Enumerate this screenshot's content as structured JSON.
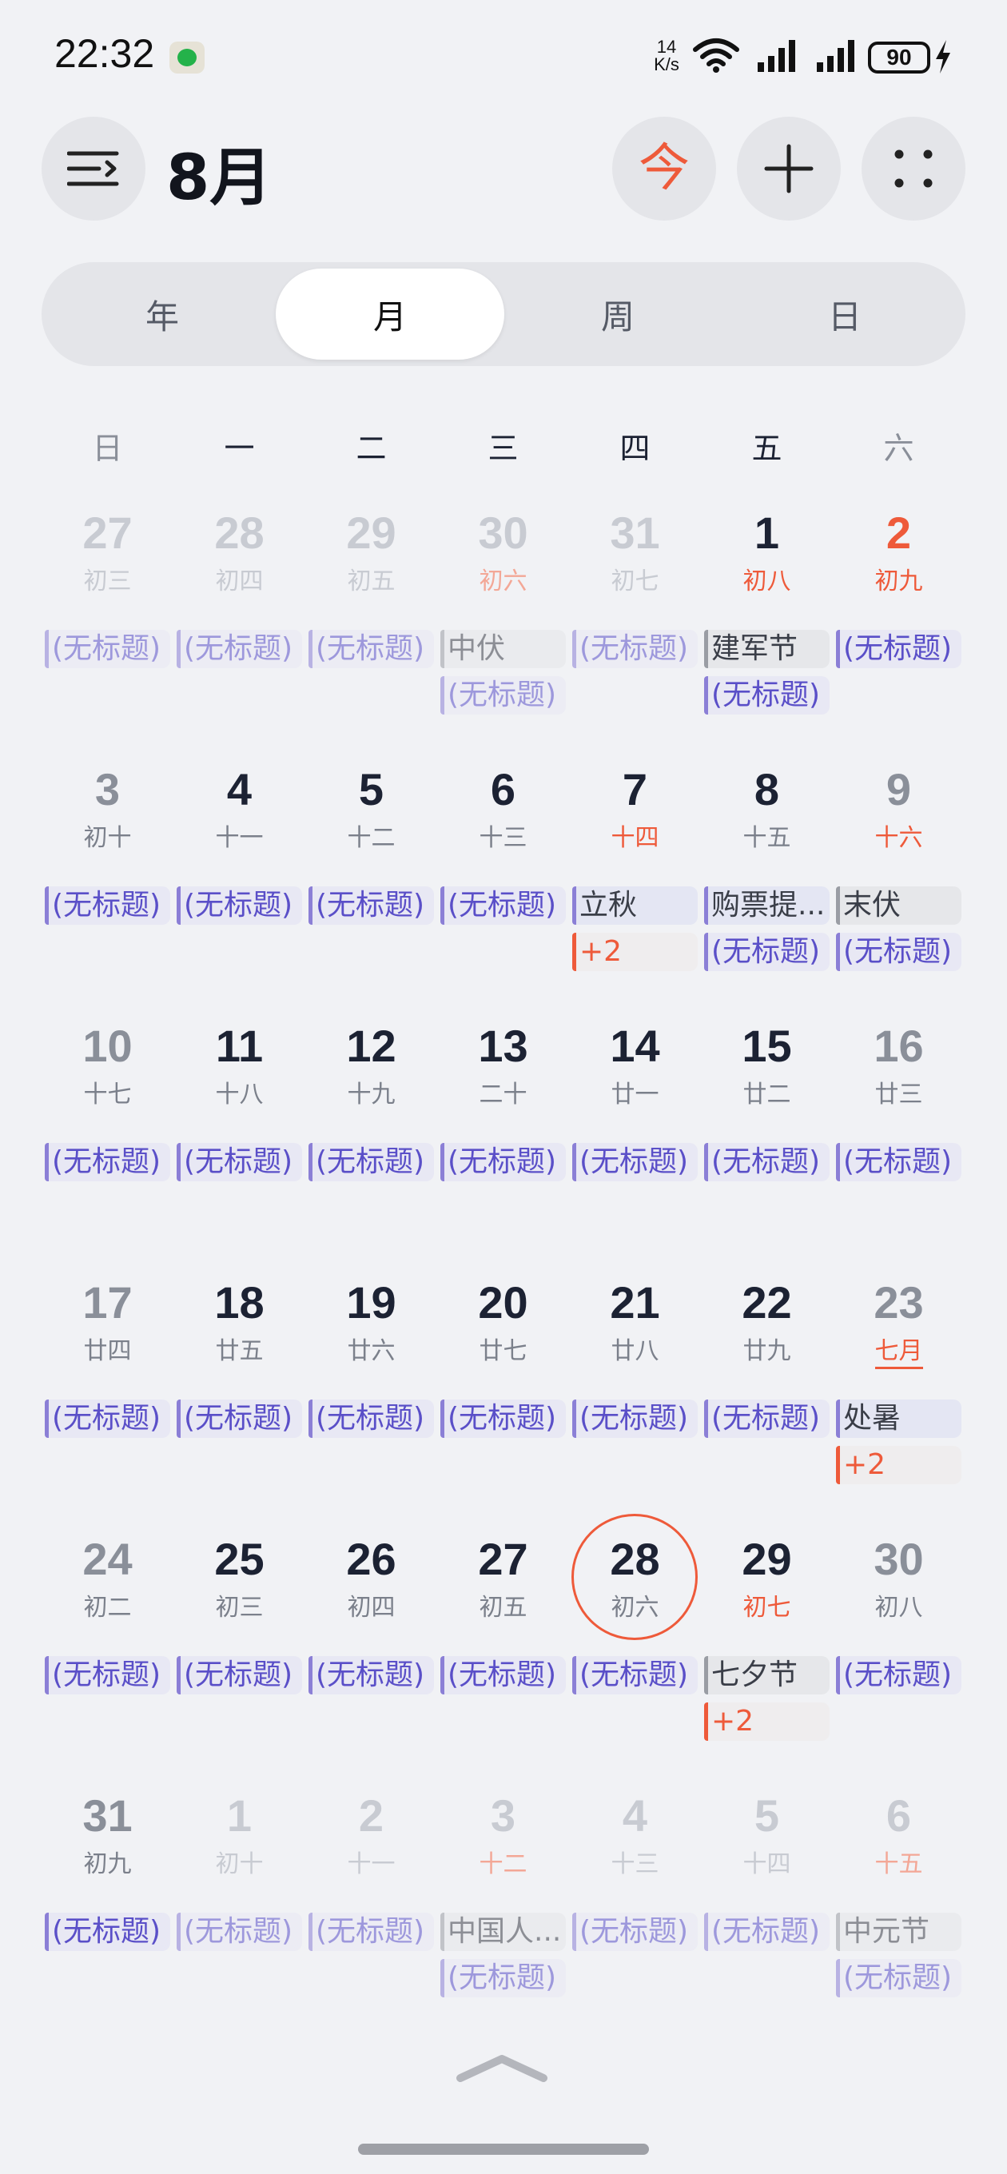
{
  "status_bar": {
    "time": "22:32",
    "speed": "14",
    "speed_unit": "K/s",
    "battery": "90"
  },
  "header": {
    "month": "8月",
    "today_label": "今"
  },
  "view_tabs": [
    {
      "label": "年"
    },
    {
      "label": "月"
    },
    {
      "label": "周"
    },
    {
      "label": "日"
    }
  ],
  "weekdays": [
    "日",
    "一",
    "二",
    "三",
    "四",
    "五",
    "六"
  ],
  "weeks": [
    [
      {
        "day": "27",
        "lunar": "初三",
        "events": [
          "(无标题)"
        ]
      },
      {
        "day": "28",
        "lunar": "初四",
        "events": [
          "(无标题)"
        ]
      },
      {
        "day": "29",
        "lunar": "初五",
        "events": [
          "(无标题)"
        ]
      },
      {
        "day": "30",
        "lunar": "初六",
        "events": [
          "中伏",
          "(无标题)"
        ]
      },
      {
        "day": "31",
        "lunar": "初七",
        "events": [
          "(无标题)"
        ]
      },
      {
        "day": "1",
        "lunar": "初八",
        "events": [
          "建军节",
          "(无标题)"
        ]
      },
      {
        "day": "2",
        "lunar": "初九",
        "events": [
          "(无标题)"
        ]
      }
    ],
    [
      {
        "day": "3",
        "lunar": "初十",
        "events": [
          "(无标题)"
        ]
      },
      {
        "day": "4",
        "lunar": "十一",
        "events": [
          "(无标题)"
        ]
      },
      {
        "day": "5",
        "lunar": "十二",
        "events": [
          "(无标题)"
        ]
      },
      {
        "day": "6",
        "lunar": "十三",
        "events": [
          "(无标题)"
        ]
      },
      {
        "day": "7",
        "lunar": "十四",
        "events": [
          "立秋",
          "+2"
        ]
      },
      {
        "day": "8",
        "lunar": "十五",
        "events": [
          "购票提...",
          "(无标题)"
        ]
      },
      {
        "day": "9",
        "lunar": "十六",
        "events": [
          "末伏",
          "(无标题)"
        ]
      }
    ],
    [
      {
        "day": "10",
        "lunar": "十七",
        "events": [
          "(无标题)"
        ]
      },
      {
        "day": "11",
        "lunar": "十八",
        "events": [
          "(无标题)"
        ]
      },
      {
        "day": "12",
        "lunar": "十九",
        "events": [
          "(无标题)"
        ]
      },
      {
        "day": "13",
        "lunar": "二十",
        "events": [
          "(无标题)"
        ]
      },
      {
        "day": "14",
        "lunar": "廿一",
        "events": [
          "(无标题)"
        ]
      },
      {
        "day": "15",
        "lunar": "廿二",
        "events": [
          "(无标题)"
        ]
      },
      {
        "day": "16",
        "lunar": "廿三",
        "events": [
          "(无标题)"
        ]
      }
    ],
    [
      {
        "day": "17",
        "lunar": "廿四",
        "events": [
          "(无标题)"
        ]
      },
      {
        "day": "18",
        "lunar": "廿五",
        "events": [
          "(无标题)"
        ]
      },
      {
        "day": "19",
        "lunar": "廿六",
        "events": [
          "(无标题)"
        ]
      },
      {
        "day": "20",
        "lunar": "廿七",
        "events": [
          "(无标题)"
        ]
      },
      {
        "day": "21",
        "lunar": "廿八",
        "events": [
          "(无标题)"
        ]
      },
      {
        "day": "22",
        "lunar": "廿九",
        "events": [
          "(无标题)"
        ]
      },
      {
        "day": "23",
        "lunar": "七月",
        "events": [
          "处暑",
          "+2"
        ]
      }
    ],
    [
      {
        "day": "24",
        "lunar": "初二",
        "events": [
          "(无标题)"
        ]
      },
      {
        "day": "25",
        "lunar": "初三",
        "events": [
          "(无标题)"
        ]
      },
      {
        "day": "26",
        "lunar": "初四",
        "events": [
          "(无标题)"
        ]
      },
      {
        "day": "27",
        "lunar": "初五",
        "events": [
          "(无标题)"
        ]
      },
      {
        "day": "28",
        "lunar": "初六",
        "events": [
          "(无标题)"
        ]
      },
      {
        "day": "29",
        "lunar": "初七",
        "events": [
          "七夕节",
          "+2"
        ]
      },
      {
        "day": "30",
        "lunar": "初八",
        "events": [
          "(无标题)"
        ]
      }
    ],
    [
      {
        "day": "31",
        "lunar": "初九",
        "events": [
          "(无标题)"
        ]
      },
      {
        "day": "1",
        "lunar": "初十",
        "events": [
          "(无标题)"
        ]
      },
      {
        "day": "2",
        "lunar": "十一",
        "events": [
          "(无标题)"
        ]
      },
      {
        "day": "3",
        "lunar": "十二",
        "events": [
          "中国人...",
          "(无标题)"
        ]
      },
      {
        "day": "4",
        "lunar": "十三",
        "events": [
          "(无标题)"
        ]
      },
      {
        "day": "5",
        "lunar": "十四",
        "events": [
          "(无标题)"
        ]
      },
      {
        "day": "6",
        "lunar": "十五",
        "events": [
          "中元节",
          "(无标题)"
        ]
      }
    ]
  ]
}
